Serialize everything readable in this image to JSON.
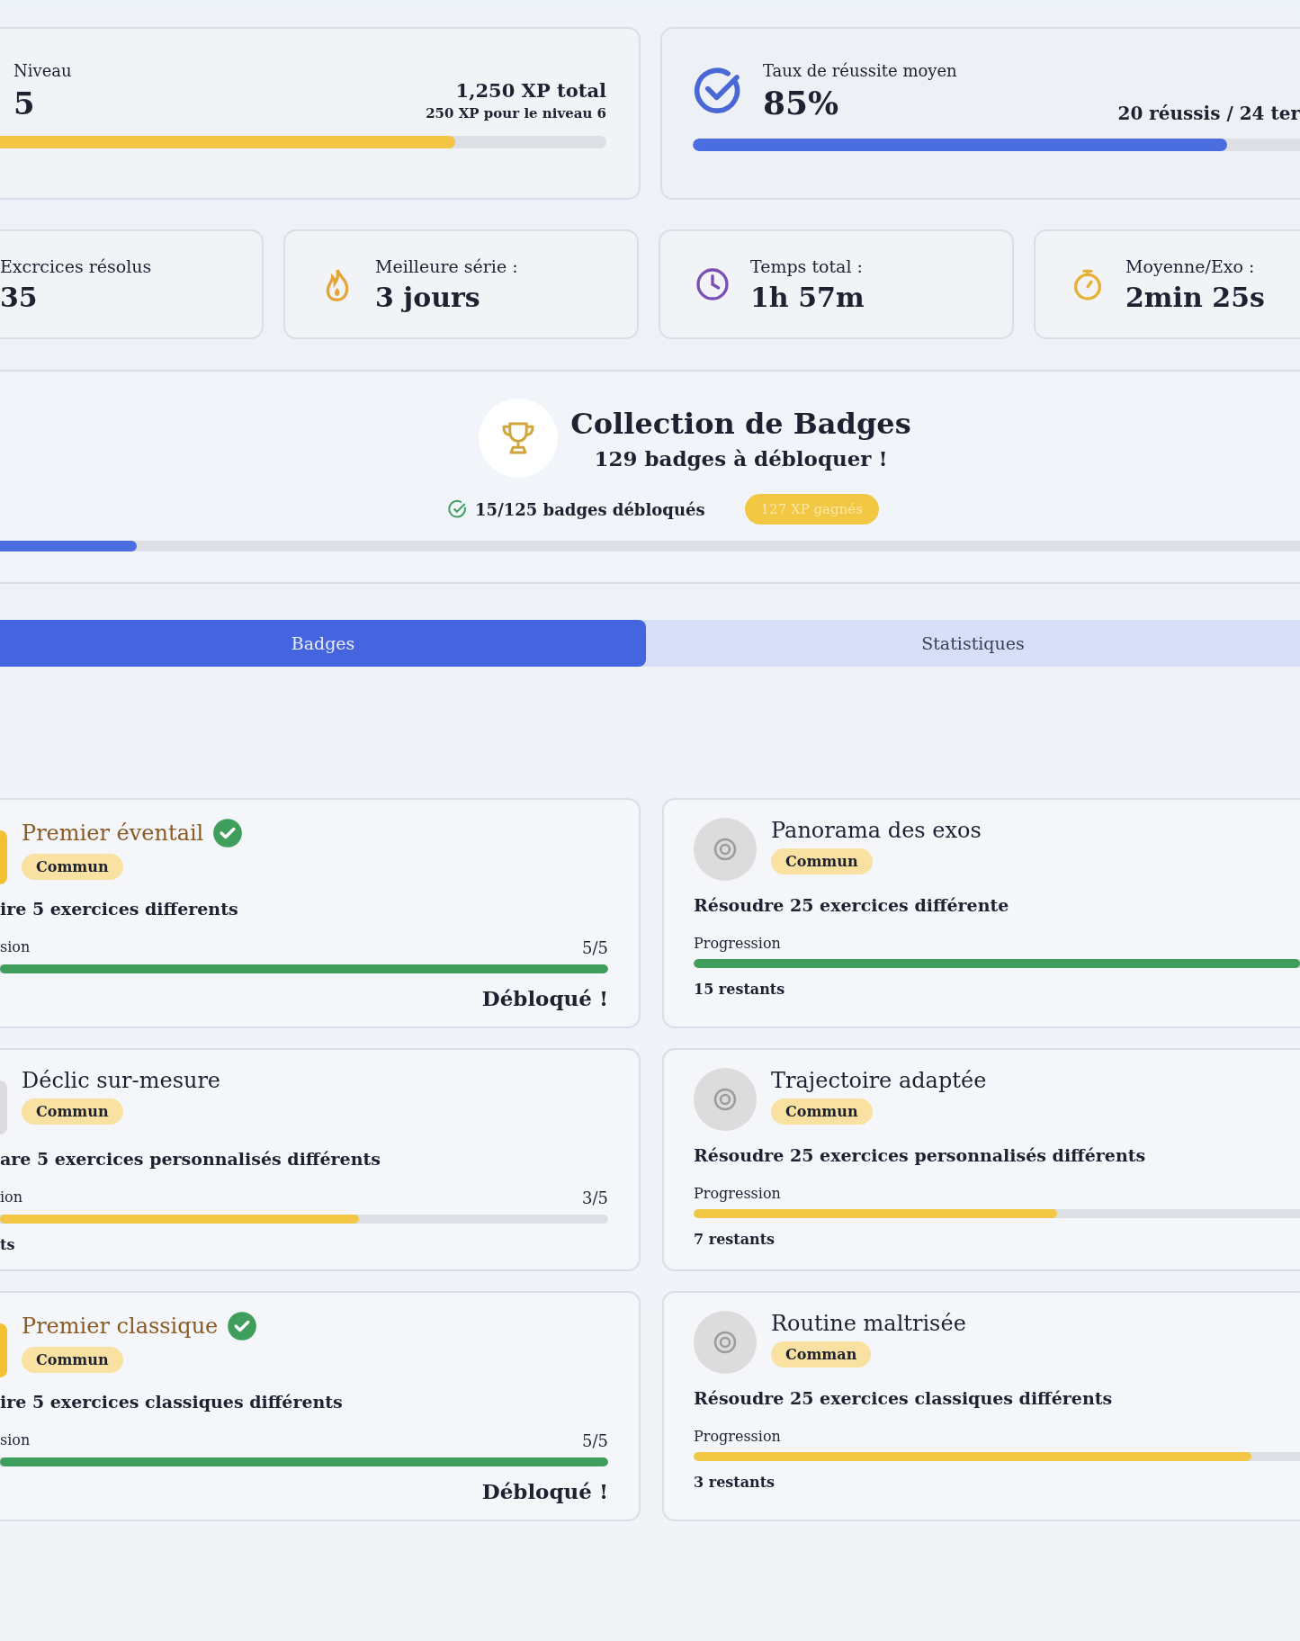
{
  "level_card": {
    "label": "Niveau",
    "value": "5",
    "total": "1,250 XP total",
    "next": "250 XP pour le niveau 6",
    "level": 0.75
  },
  "success_card": {
    "label": "Taux de réussite moyen",
    "value": "85%",
    "detail": "20 réussis / 24 ter",
    "level": 0.88
  },
  "stats": [
    {
      "kind": "count",
      "label": "Excrcices résolus",
      "value": "35"
    },
    {
      "kind": "streak",
      "label": "Meilleure série :",
      "value": "3 jours"
    },
    {
      "kind": "time",
      "label": "Temps total :",
      "value": "1h 57m"
    },
    {
      "kind": "average",
      "label": "Moyenne/Exo :",
      "value": "2min 25s"
    }
  ],
  "collection": {
    "title": "Collection de Badges",
    "subtitle": "129 badges à débloquer !",
    "unlocked_text": "15/125 badges débloqués",
    "xp_badge": "127 XP gagnés",
    "level": 0.105
  },
  "tabs": [
    {
      "label": "Badges",
      "selected": true
    },
    {
      "label": "Statistiques",
      "selected": false
    }
  ],
  "badges": [
    {
      "title": "Premier éventail",
      "unlocked": true,
      "rarity": "Commun",
      "description": "ire 5 exercices differents",
      "progress_label": "sion",
      "count": "5/5",
      "level": 1,
      "color": "#3f9e5c",
      "footer": "Débloqué !"
    },
    {
      "title": "Panorama des exos",
      "unlocked": false,
      "rarity": "Commun",
      "description": "Résoudre 25 exercices différente",
      "progress_label": "Progression",
      "level": 1,
      "color": "#3f9e5c",
      "footer": "15 restants"
    },
    {
      "title": "Déclic sur-mesure",
      "unlocked": false,
      "rarity": "Commun",
      "description": "are 5 exercices personnalisés différents",
      "progress_label": "ion",
      "count": "3/5",
      "level": 0.59,
      "color": "#f2c744",
      "footer": "ts"
    },
    {
      "title": "Trajectoire adaptée",
      "unlocked": false,
      "rarity": "Commun",
      "description": "Résoudre 25 exercices personnalisés différents",
      "progress_label": "Progression",
      "level": 0.6,
      "color": "#f2c744",
      "footer": "7 restants"
    },
    {
      "title": "Premier classique",
      "unlocked": true,
      "rarity": "Commun",
      "description": "ire 5 exercices classiques différents",
      "progress_label": "sion",
      "count": "5/5",
      "level": 1,
      "color": "#3f9e5c",
      "footer": "Débloqué !"
    },
    {
      "title": "Routine maltrisée",
      "unlocked": false,
      "rarity": "Comman",
      "description": "Résoudre 25 exercices classiques différents",
      "progress_label": "Progression",
      "level": 0.92,
      "color": "#f2c744",
      "footer": "3 restants"
    }
  ]
}
